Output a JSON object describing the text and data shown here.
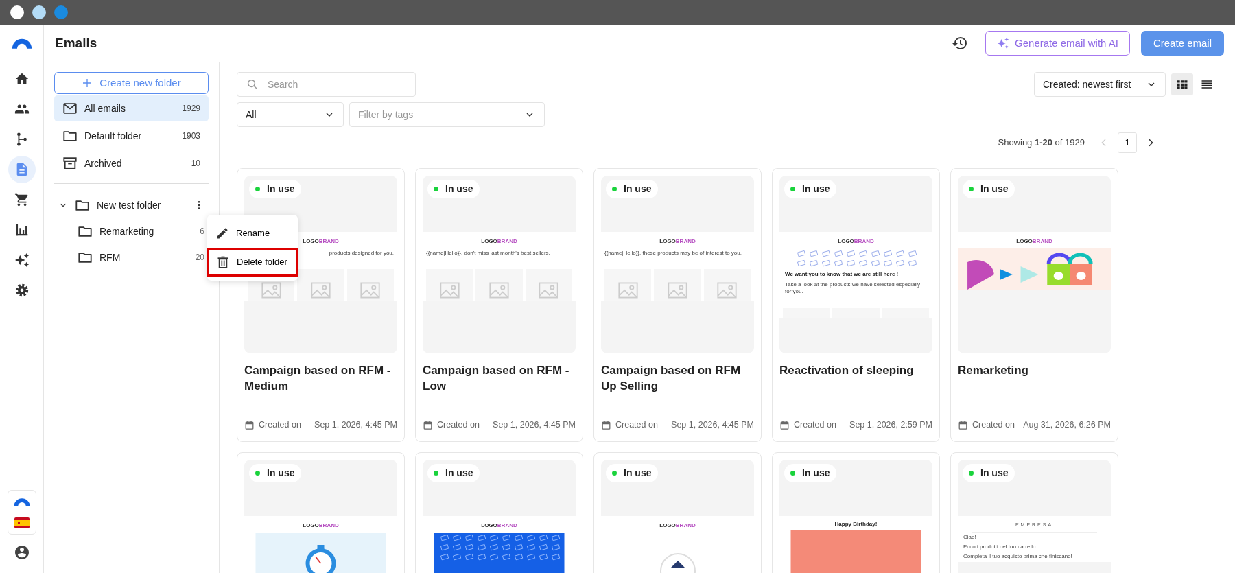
{
  "window_controls": [
    {
      "color": "#ffffff"
    },
    {
      "color": "#b3dcf7"
    },
    {
      "color": "#1a8be0"
    }
  ],
  "nav": [
    {
      "selected": false
    },
    {
      "selected": false
    },
    {
      "selected": false
    },
    {
      "selected": true
    },
    {
      "selected": false
    },
    {
      "selected": false
    },
    {
      "selected": false
    },
    {
      "selected": false
    }
  ],
  "header": {
    "title": "Emails",
    "ai_button": "Generate email with AI",
    "create_button": "Create email"
  },
  "folders": {
    "create_button": "Create new folder",
    "items": [
      {
        "kind": "mail",
        "label": "All emails",
        "count": "1929",
        "selected": true
      },
      {
        "kind": "folder",
        "label": "Default folder",
        "count": "1903",
        "selected": false
      },
      {
        "kind": "archive",
        "label": "Archived",
        "count": "10",
        "selected": false
      }
    ],
    "tree": [
      {
        "label": "New test folder",
        "expanded": true,
        "children": [
          {
            "label": "Remarketing",
            "count": "6"
          },
          {
            "label": "RFM",
            "count": "20"
          }
        ]
      }
    ]
  },
  "context_menu": {
    "items": [
      {
        "kind": "rename",
        "label": "Rename",
        "highlighted": false
      },
      {
        "kind": "delete",
        "label": "Delete folder",
        "highlighted": true
      }
    ]
  },
  "toolbar": {
    "search_placeholder": "Search",
    "status_filter": "All",
    "tags_placeholder": "Filter by tags",
    "sort": "Created: newest first",
    "views": [
      {
        "kind": "grid",
        "selected": true
      },
      {
        "kind": "list",
        "selected": false
      }
    ]
  },
  "pagination": {
    "summary": "Showing **1-20** of 1929",
    "page": "1",
    "prev_disabled": true
  },
  "emails": [
    {
      "status": "In use",
      "title": "Campaign based on RFM - Medium",
      "created_label": "Created on",
      "date": "Sep 1, 2026, 4:45 PM",
      "preview": {
        "kind": "products-tail",
        "logo": {
          "dark": "LOGO",
          "accent": "BRAND"
        },
        "lines": [
          "products designed for you."
        ]
      }
    },
    {
      "status": "In use",
      "title": "Campaign based on RFM - Low",
      "created_label": "Created on",
      "date": "Sep 1, 2026, 4:45 PM",
      "preview": {
        "kind": "products",
        "logo": {
          "dark": "LOGO",
          "accent": "BRAND"
        },
        "lines": [
          "{{name|Hello}}, don't miss last month's best sellers."
        ]
      }
    },
    {
      "status": "In use",
      "title": "Campaign based on RFM Up Selling",
      "created_label": "Created on",
      "date": "Sep 1, 2026, 4:45 PM",
      "preview": {
        "kind": "products",
        "logo": {
          "dark": "LOGO",
          "accent": "BRAND"
        },
        "lines": [
          "{{name|Hello}}, these products may be of interest to you."
        ]
      }
    },
    {
      "status": "In use",
      "title": "Reactivation of sleeping",
      "created_label": "Created on",
      "date": "Sep 1, 2026, 2:59 PM",
      "preview": {
        "kind": "letters",
        "logo": {
          "dark": "LOGO",
          "accent": "BRAND"
        },
        "heading": "We want you to know that we are still here !",
        "lines": [
          "Take a look at the products we have selected especially for you."
        ]
      }
    },
    {
      "status": "In use",
      "title": "Remarketing",
      "created_label": "Created on",
      "date": "Aug 31, 2026, 6:26 PM",
      "preview": {
        "kind": "shapes",
        "logo": {
          "dark": "LOGO",
          "accent": "BRAND"
        }
      }
    },
    {
      "status": "In use",
      "preview": {
        "kind": "clock",
        "logo": {
          "dark": "LOGO",
          "accent": "BRAND"
        }
      }
    },
    {
      "status": "In use",
      "preview": {
        "kind": "banner",
        "logo": {
          "dark": "LOGO",
          "accent": "BRAND"
        }
      }
    },
    {
      "status": "In use",
      "preview": {
        "kind": "round",
        "logo": {
          "dark": "LOGO",
          "accent": "BRAND"
        }
      }
    },
    {
      "status": "In use",
      "preview": {
        "kind": "birthday",
        "heading": "Happy Birthday!"
      }
    },
    {
      "status": "In use",
      "preview": {
        "kind": "empresa",
        "heading": "EMPRESA",
        "lines": [
          "Ciao!",
          "Ecco i prodotti del tuo carrello.",
          "Completa il tuo acquisto prima che finiscano!"
        ]
      }
    }
  ]
}
